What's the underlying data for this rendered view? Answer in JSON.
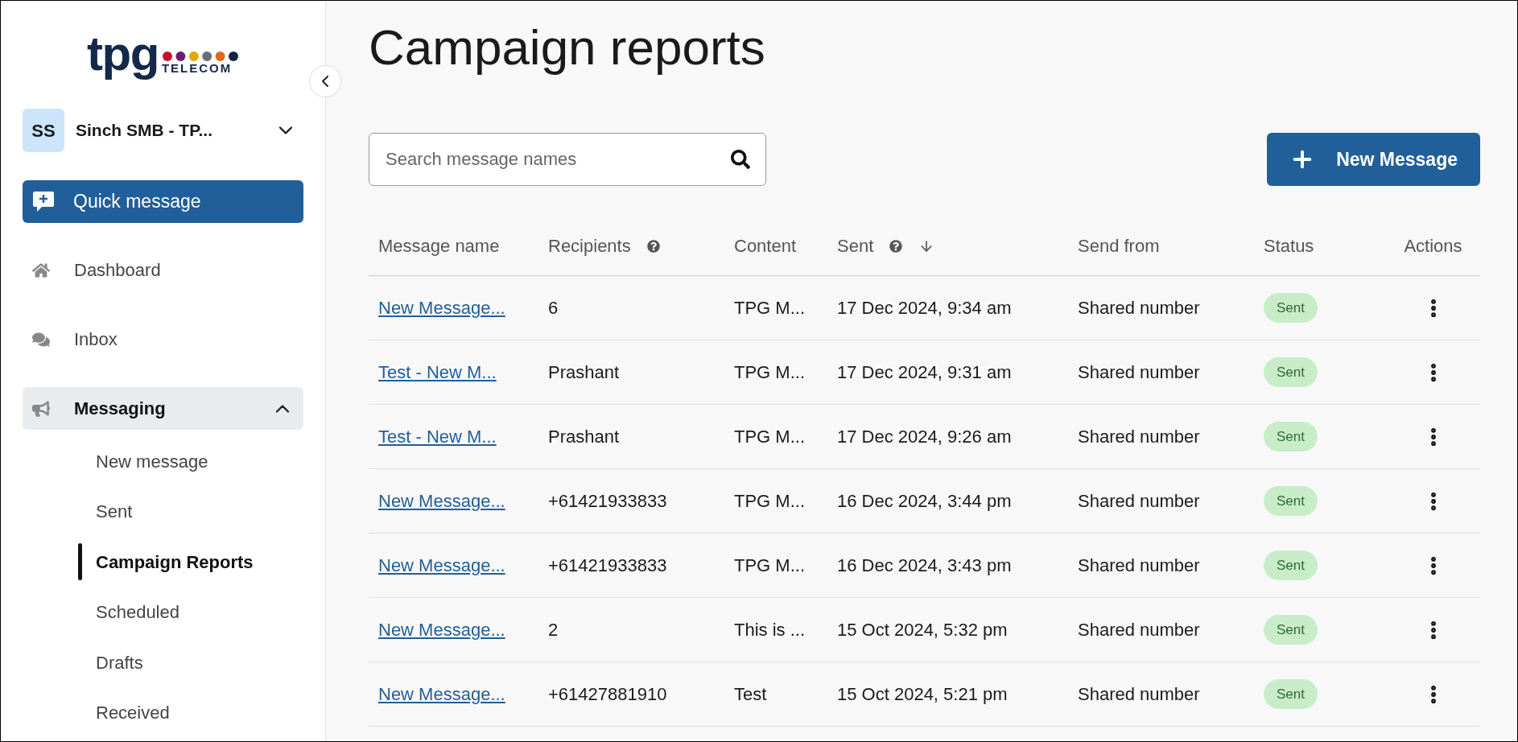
{
  "logo": {
    "wordmark": "tpg",
    "tagline": "TELECOM"
  },
  "account": {
    "initials": "SS",
    "name": "Sinch SMB - TP..."
  },
  "quick_message": {
    "label": "Quick message"
  },
  "nav": [
    {
      "label": "Dashboard"
    },
    {
      "label": "Inbox"
    },
    {
      "label": "Messaging",
      "expanded": true,
      "children": [
        {
          "label": "New message",
          "selected": false
        },
        {
          "label": "Sent",
          "selected": false
        },
        {
          "label": "Campaign Reports",
          "selected": true
        },
        {
          "label": "Scheduled",
          "selected": false
        },
        {
          "label": "Drafts",
          "selected": false
        },
        {
          "label": "Received",
          "selected": false
        }
      ]
    }
  ],
  "page": {
    "title": "Campaign reports"
  },
  "search": {
    "placeholder": "Search message names"
  },
  "new_message_button": {
    "label": "New Message"
  },
  "table": {
    "columns": [
      {
        "label": "Message name",
        "help": false,
        "sorted": false
      },
      {
        "label": "Recipients",
        "help": true,
        "sorted": false
      },
      {
        "label": "Content",
        "help": false,
        "sorted": false
      },
      {
        "label": "Sent",
        "help": true,
        "sorted": true
      },
      {
        "label": "Send from",
        "help": false,
        "sorted": false
      },
      {
        "label": "Status",
        "help": false,
        "sorted": false
      },
      {
        "label": "Actions",
        "help": false,
        "sorted": false
      }
    ],
    "rows": [
      {
        "name": "New Message...",
        "recipients": "6",
        "content": "TPG M...",
        "sent": "17 Dec 2024, 9:34 am",
        "send_from": "Shared number",
        "status": "Sent"
      },
      {
        "name": "Test - New M...",
        "recipients": "Prashant",
        "content": "TPG M...",
        "sent": "17 Dec 2024, 9:31 am",
        "send_from": "Shared number",
        "status": "Sent"
      },
      {
        "name": "Test - New M...",
        "recipients": "Prashant",
        "content": "TPG M...",
        "sent": "17 Dec 2024, 9:26 am",
        "send_from": "Shared number",
        "status": "Sent"
      },
      {
        "name": "New Message...",
        "recipients": "+61421933833",
        "content": "TPG M...",
        "sent": "16 Dec 2024, 3:44 pm",
        "send_from": "Shared number",
        "status": "Sent"
      },
      {
        "name": "New Message...",
        "recipients": "+61421933833",
        "content": "TPG M...",
        "sent": "16 Dec 2024, 3:43 pm",
        "send_from": "Shared number",
        "status": "Sent"
      },
      {
        "name": "New Message...",
        "recipients": "2",
        "content": "This is ...",
        "sent": "15 Oct 2024, 5:32 pm",
        "send_from": "Shared number",
        "status": "Sent"
      },
      {
        "name": "New Message...",
        "recipients": "+61427881910",
        "content": "Test",
        "sent": "15 Oct 2024, 5:21 pm",
        "send_from": "Shared number",
        "status": "Sent"
      }
    ]
  }
}
